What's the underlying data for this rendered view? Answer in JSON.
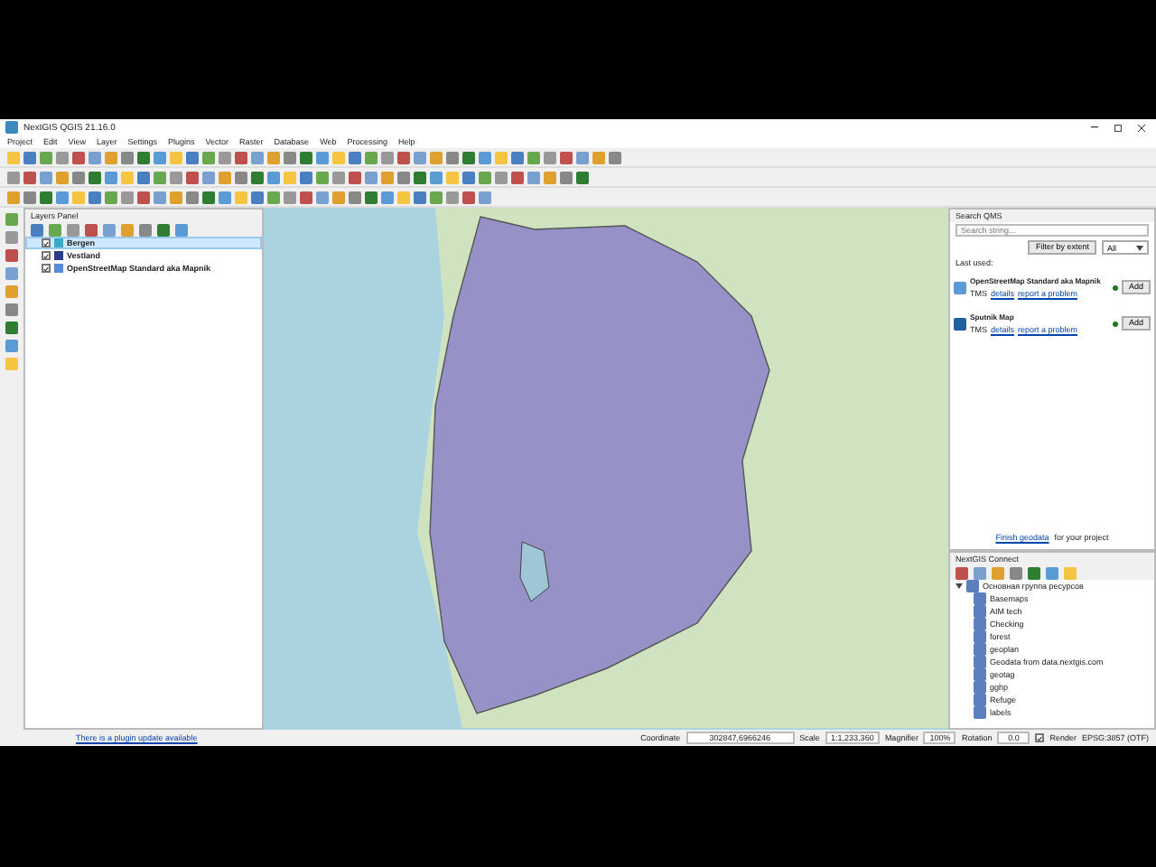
{
  "window": {
    "title": "NextGIS QGIS 21.16.0"
  },
  "menu": [
    "Project",
    "Edit",
    "View",
    "Layer",
    "Settings",
    "Plugins",
    "Vector",
    "Raster",
    "Database",
    "Web",
    "Processing",
    "Help"
  ],
  "layers_panel": {
    "title": "Layers Panel",
    "layers": [
      {
        "name": "Bergen",
        "checked": true,
        "selected": true,
        "color": "#3aa8c8"
      },
      {
        "name": "Vestland",
        "checked": true,
        "selected": false,
        "color": "#2a3a8a"
      },
      {
        "name": "OpenStreetMap Standard aka Mapnik",
        "checked": true,
        "selected": false,
        "color": "#5a8ad0"
      }
    ]
  },
  "search_qms": {
    "title": "Search QMS",
    "placeholder": "Search string...",
    "filter_button": "Filter by extent",
    "filter_value": "All",
    "section": "Last used:",
    "results": [
      {
        "name": "OpenStreetMap Standard aka Mapnik",
        "type": "TMS",
        "links": [
          "details",
          "report a problem"
        ],
        "button": "Add"
      },
      {
        "name": "Sputnik Map",
        "type": "TMS",
        "links": [
          "details",
          "report a problem"
        ],
        "button": "Add"
      }
    ],
    "footer_link": "Finish geodata",
    "footer_text": "for your project"
  },
  "nextgis_connect": {
    "title": "NextGIS Connect",
    "root": {
      "name": "Основная группа ресурсов",
      "expanded": true,
      "children": [
        {
          "name": "Basemaps"
        },
        {
          "name": "AIM tech"
        },
        {
          "name": "Checking"
        },
        {
          "name": "forest"
        },
        {
          "name": "geoplan"
        },
        {
          "name": "Geodata from data.nextgis.com"
        },
        {
          "name": "geotag"
        },
        {
          "name": "gghp"
        },
        {
          "name": "Refuge"
        },
        {
          "name": "labels"
        }
      ]
    }
  },
  "status_bar": {
    "message": "There is a plugin update available",
    "coordinate_label": "Coordinate",
    "coordinate": "302847,6966246",
    "scale_label": "Scale",
    "scale": "1:1,233,360",
    "magnifier_label": "Magnifier",
    "magnifier": "100%",
    "rotation_label": "Rotation",
    "rotation": "0.0",
    "render_label": "Render",
    "render_checked": true,
    "crs": "EPSG:3857 (OTF)"
  }
}
